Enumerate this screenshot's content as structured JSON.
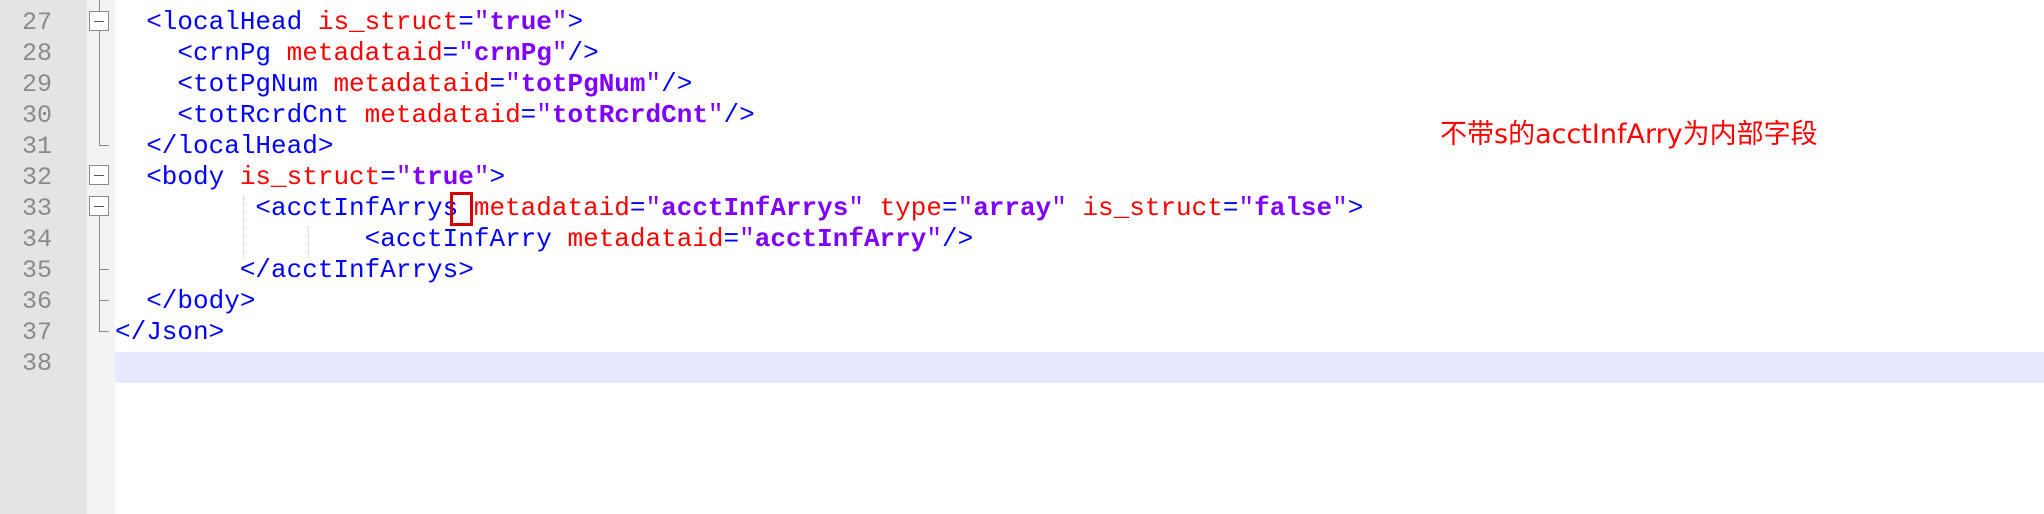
{
  "editor": {
    "lines": [
      {
        "num": "27",
        "parts": [
          {
            "c": "t",
            "s": "  <localHead "
          },
          {
            "c": "a",
            "s": "is_struct"
          },
          {
            "c": "t",
            "s": "="
          },
          {
            "c": "q",
            "s": "\""
          },
          {
            "c": "v",
            "s": "true"
          },
          {
            "c": "q",
            "s": "\""
          },
          {
            "c": "t",
            "s": ">"
          }
        ]
      },
      {
        "num": "28",
        "parts": [
          {
            "c": "t",
            "s": "    <crnPg "
          },
          {
            "c": "a",
            "s": "metadataid"
          },
          {
            "c": "t",
            "s": "="
          },
          {
            "c": "q",
            "s": "\""
          },
          {
            "c": "v",
            "s": "crnPg"
          },
          {
            "c": "q",
            "s": "\""
          },
          {
            "c": "t",
            "s": "/>"
          }
        ]
      },
      {
        "num": "29",
        "parts": [
          {
            "c": "t",
            "s": "    <totPgNum "
          },
          {
            "c": "a",
            "s": "metadataid"
          },
          {
            "c": "t",
            "s": "="
          },
          {
            "c": "q",
            "s": "\""
          },
          {
            "c": "v",
            "s": "totPgNum"
          },
          {
            "c": "q",
            "s": "\""
          },
          {
            "c": "t",
            "s": "/>"
          }
        ]
      },
      {
        "num": "30",
        "parts": [
          {
            "c": "t",
            "s": "    <totRcrdCnt "
          },
          {
            "c": "a",
            "s": "metadataid"
          },
          {
            "c": "t",
            "s": "="
          },
          {
            "c": "q",
            "s": "\""
          },
          {
            "c": "v",
            "s": "totRcrdCnt"
          },
          {
            "c": "q",
            "s": "\""
          },
          {
            "c": "t",
            "s": "/>"
          }
        ]
      },
      {
        "num": "31",
        "parts": [
          {
            "c": "t",
            "s": "  </localHead>"
          }
        ]
      },
      {
        "num": "32",
        "parts": [
          {
            "c": "t",
            "s": "  <body "
          },
          {
            "c": "a",
            "s": "is_struct"
          },
          {
            "c": "t",
            "s": "="
          },
          {
            "c": "q",
            "s": "\""
          },
          {
            "c": "v",
            "s": "true"
          },
          {
            "c": "q",
            "s": "\""
          },
          {
            "c": "t",
            "s": ">"
          }
        ]
      },
      {
        "num": "33",
        "parts": [
          {
            "c": "t",
            "s": "         <acctInfArrys "
          },
          {
            "c": "a",
            "s": "metadataid"
          },
          {
            "c": "t",
            "s": "="
          },
          {
            "c": "q",
            "s": "\""
          },
          {
            "c": "v",
            "s": "acctInfArrys"
          },
          {
            "c": "q",
            "s": "\""
          },
          {
            "c": "t",
            "s": " "
          },
          {
            "c": "a",
            "s": "type"
          },
          {
            "c": "t",
            "s": "="
          },
          {
            "c": "q",
            "s": "\""
          },
          {
            "c": "v",
            "s": "array"
          },
          {
            "c": "q",
            "s": "\""
          },
          {
            "c": "t",
            "s": " "
          },
          {
            "c": "a",
            "s": "is_struct"
          },
          {
            "c": "t",
            "s": "="
          },
          {
            "c": "q",
            "s": "\""
          },
          {
            "c": "v",
            "s": "false"
          },
          {
            "c": "q",
            "s": "\""
          },
          {
            "c": "t",
            "s": ">"
          }
        ]
      },
      {
        "num": "34",
        "parts": [
          {
            "c": "t",
            "s": "                <acctInfArry "
          },
          {
            "c": "a",
            "s": "metadataid"
          },
          {
            "c": "t",
            "s": "="
          },
          {
            "c": "q",
            "s": "\""
          },
          {
            "c": "v",
            "s": "acctInfArry"
          },
          {
            "c": "q",
            "s": "\""
          },
          {
            "c": "t",
            "s": "/>"
          }
        ]
      },
      {
        "num": "35",
        "parts": [
          {
            "c": "t",
            "s": "        </acctInfArrys>"
          }
        ]
      },
      {
        "num": "36",
        "parts": [
          {
            "c": "t",
            "s": "  </body>"
          }
        ]
      },
      {
        "num": "37",
        "parts": [
          {
            "c": "t",
            "s": "</Json>"
          }
        ]
      },
      {
        "num": "38",
        "parts": []
      }
    ],
    "colors": {
      "tag": "#0000ff",
      "attr": "#ff0000",
      "value": "#8000ff",
      "annotation": "#ff0000",
      "current_line": "#e8e8ff"
    }
  },
  "annotation": {
    "text": "不带s的acctInfArry为内部字段"
  }
}
